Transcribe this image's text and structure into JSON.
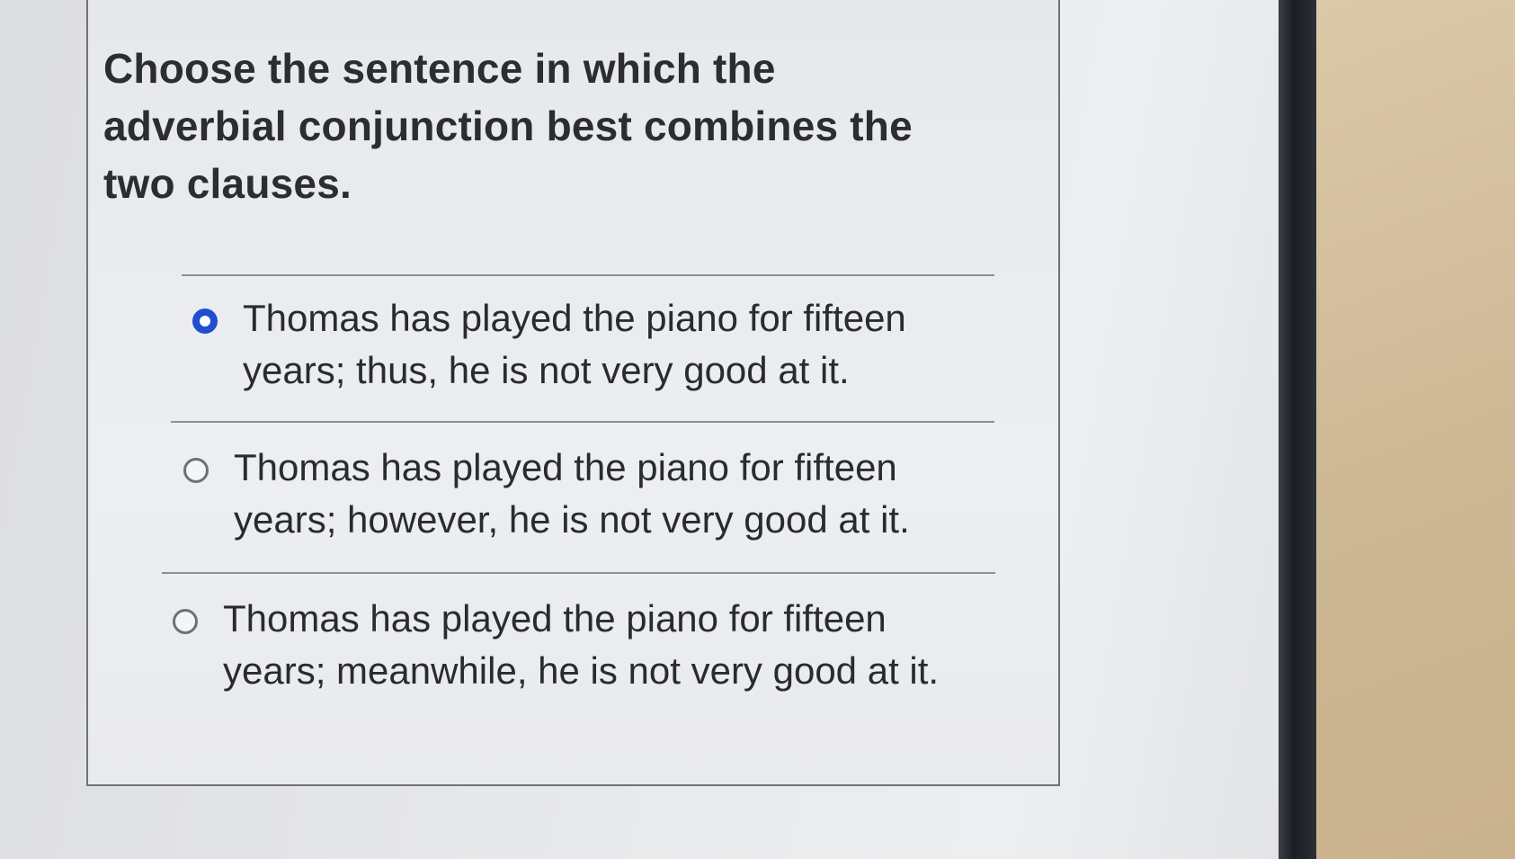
{
  "question": {
    "prompt": "Choose the sentence in which the adverbial conjunction best combines the two clauses."
  },
  "choices": [
    {
      "label": "Thomas has played the piano for fifteen years; thus, he is not very good at it.",
      "selected": true
    },
    {
      "label": "Thomas has played the piano for fifteen years; however, he is not very good at it.",
      "selected": false
    },
    {
      "label": "Thomas has played the piano for fifteen years; meanwhile, he is not very good at it.",
      "selected": false
    }
  ],
  "colors": {
    "selected_radio": "#1f4fd0",
    "text": "#2a2b2e",
    "border": "#6f7278"
  }
}
